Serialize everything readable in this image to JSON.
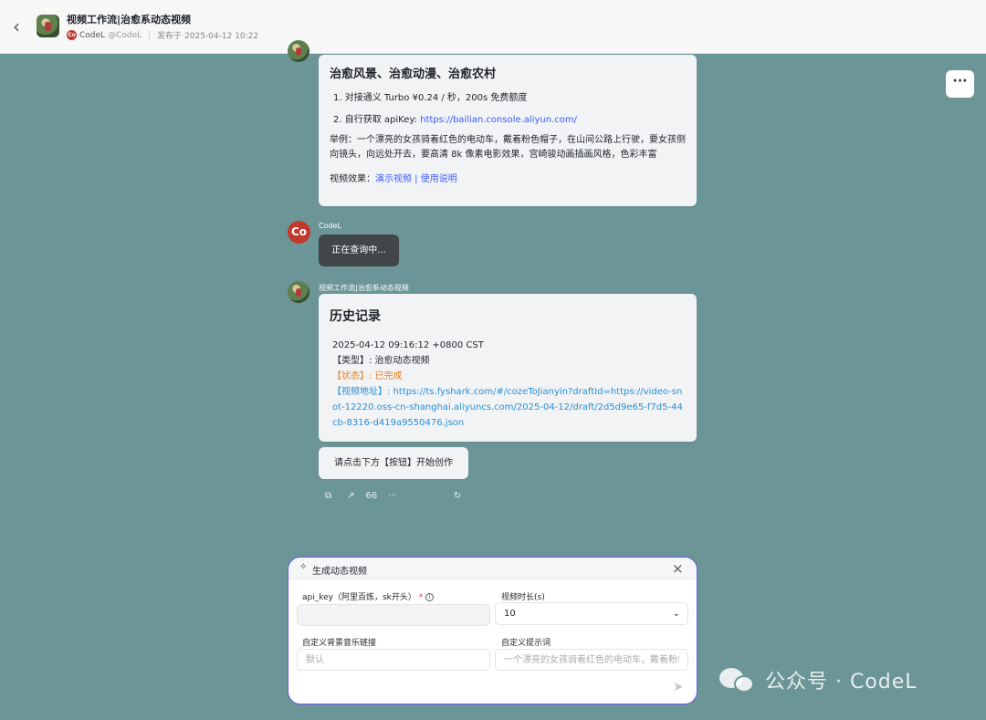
{
  "header": {
    "back_icon": "chevron-left-icon",
    "title": "视频工作流|治愈系动态视频",
    "author_badge": "Co",
    "author": "CodeL",
    "handle": "@CodeL",
    "published": "发布于 2025-04-12 10:22"
  },
  "more_button": "···",
  "card1": {
    "title": "治愈风景、治愈动漫、治愈农村",
    "item1": "1. 对接通义 Turbo ¥0.24 / 秒，200s 免费额度",
    "item2_prefix": "2. 自行获取 apiKey: ",
    "item2_link": "https://bailian.console.aliyun.com/",
    "example": "举例：一个漂亮的女孩骑着红色的电动车，戴着粉色帽子，在山间公路上行驶，要女孩侧向镜头，向远处开去，要高清 8k 像素电影效果，宫崎骏动画插画风格，色彩丰富",
    "effect_label": "视频效果：",
    "demo_link": "演示视频",
    "link_sep": " | ",
    "usage_link": "使用说明"
  },
  "user_msg": {
    "avatar": "Co",
    "sender": "CodeL",
    "text": "正在查询中..."
  },
  "bot_msg": {
    "sender": "视频工作流|治愈系动态视频",
    "title": "历史记录",
    "datetime": "2025-04-12 09:16:12 +0800 CST",
    "type": "【类型】: 治愈动态视频",
    "status": "【状态】: 已完成",
    "url_label": "【视频地址】: ",
    "url": "https://ts.fyshark.com/#/cozeToJianyin?draftId=https://video-snot-12220.oss-cn-shanghai.aliyuncs.com/2025-04-12/draft/2d5d9e65-f7d5-44cb-8316-d419a9550476.json"
  },
  "prompt_msg": "请点击下方【按钮】开始创作",
  "actions": {
    "copy": "copy-icon",
    "share": "share-icon",
    "quote": "66",
    "more": "···",
    "regenerate": "refresh-icon"
  },
  "panel": {
    "title": "生成动态视频",
    "api_key_label": "api_key（阿里百炼，sk开头）",
    "required_mark": "*",
    "api_key_value": "",
    "duration_label": "视频时长(s)",
    "duration_value": "10",
    "music_label": "自定义背景音乐链接",
    "music_placeholder": "默认",
    "prompt_label": "自定义提示词",
    "prompt_placeholder": "一个漂亮的女孩骑着红色的电动车，戴着粉色帽子"
  },
  "watermark": "公众号 · CodeL"
}
